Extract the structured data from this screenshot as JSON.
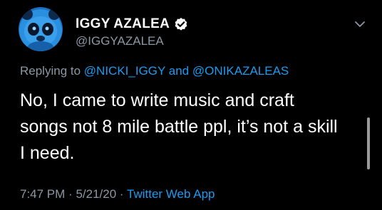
{
  "tweet": {
    "author": {
      "display_name": "IGGY AZALEA",
      "handle": "@IGGYAZALEA",
      "verified": true,
      "avatar_icon": "blue-panda-avatar"
    },
    "reply": {
      "prefix": "Replying to",
      "mention_1": "@NICKI_IGGY",
      "joiner": "and",
      "mention_2": "@ONIKAZALEAS"
    },
    "text_lines": [
      "No, I came to write music and craft",
      "songs not 8 mile battle ppl, it’s not a skill",
      "I need."
    ],
    "time": "7:47 PM",
    "separator": "·",
    "date": "5/21/20",
    "source": "Twitter Web App"
  },
  "colors": {
    "background": "#000000",
    "text": "#ffffff",
    "secondary_text": "#8b98a5",
    "link": "#1d9bf0",
    "avatar_blue": "#1f86d8"
  },
  "icons": {
    "verified": "verified-badge-icon",
    "menu": "chevron-down-icon"
  }
}
